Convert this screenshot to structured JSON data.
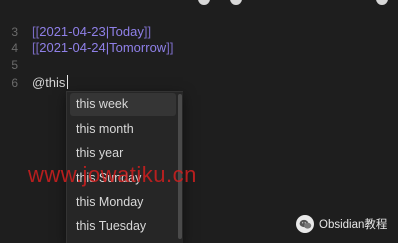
{
  "editor": {
    "lines": [
      {
        "number": "",
        "text": ""
      },
      {
        "number": "3",
        "link_date": "2021-04-23",
        "link_alias": "Today"
      },
      {
        "number": "4",
        "link_date": "2021-04-24",
        "link_alias": "Tomorrow"
      },
      {
        "number": "5",
        "text": ""
      },
      {
        "number": "6",
        "text": "@this"
      }
    ],
    "brackets": {
      "open": "[[",
      "pipe": "|",
      "close": "]]"
    }
  },
  "suggestions": {
    "items": [
      {
        "label": "this week",
        "selected": true
      },
      {
        "label": "this month",
        "selected": false
      },
      {
        "label": "this year",
        "selected": false
      },
      {
        "label": "this Sunday",
        "selected": false
      },
      {
        "label": "this Monday",
        "selected": false
      },
      {
        "label": "this Tuesday",
        "selected": false
      }
    ]
  },
  "watermark": {
    "text": "www.jowatiku.cn"
  },
  "brand": {
    "label": "Obsidian教程",
    "icon": "wechat-icon"
  },
  "colors": {
    "background": "#1e1e1e",
    "link": "#8f80e8",
    "bracket": "#7b6cc4",
    "watermark": "#d21e1e"
  }
}
